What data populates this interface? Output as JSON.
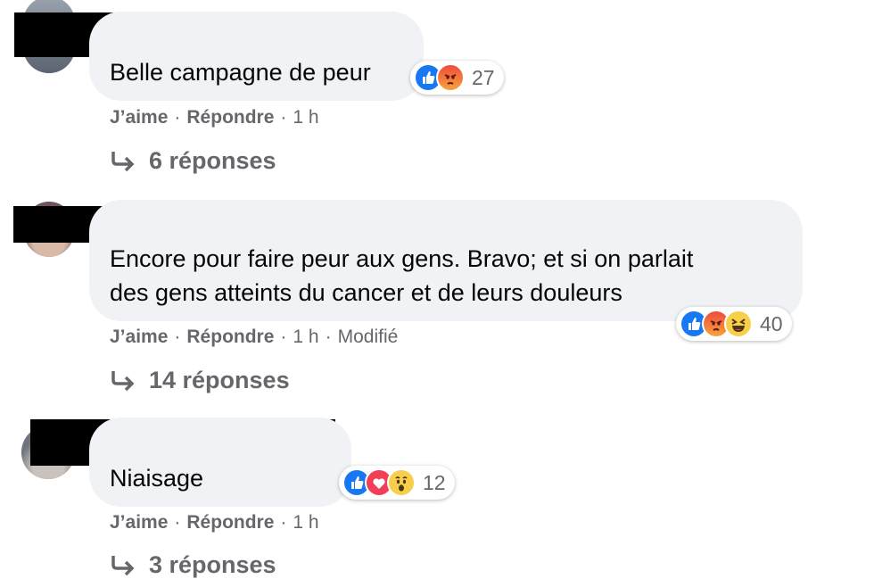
{
  "comments": [
    {
      "text_lines": [
        "Belle campagne de peur"
      ],
      "actions": {
        "like": "J’aime",
        "reply": "Répondre",
        "time": "1 h",
        "edited": ""
      },
      "reactions": {
        "icons": [
          "like-icon",
          "angry-icon"
        ],
        "count": "27"
      },
      "replies": "6 réponses"
    },
    {
      "text_lines": [
        "Encore pour faire peur aux gens. Bravo; et si on parlait",
        "des gens atteints du cancer et de leurs douleurs"
      ],
      "actions": {
        "like": "J’aime",
        "reply": "Répondre",
        "time": "1 h",
        "edited": "Modifié"
      },
      "reactions": {
        "icons": [
          "like-icon",
          "angry-icon",
          "haha-icon"
        ],
        "count": "40"
      },
      "replies": "14 réponses"
    },
    {
      "text_lines": [
        "Niaisage"
      ],
      "actions": {
        "like": "J’aime",
        "reply": "Répondre",
        "time": "1 h",
        "edited": ""
      },
      "reactions": {
        "icons": [
          "like-icon",
          "love-icon",
          "wow-icon"
        ],
        "count": "12"
      },
      "replies": "3 réponses"
    }
  ],
  "separator": "·",
  "colors": {
    "bubble": "#f0f2f5",
    "meta": "#65676b",
    "like": "#1877f2",
    "redaction": "#000000"
  }
}
